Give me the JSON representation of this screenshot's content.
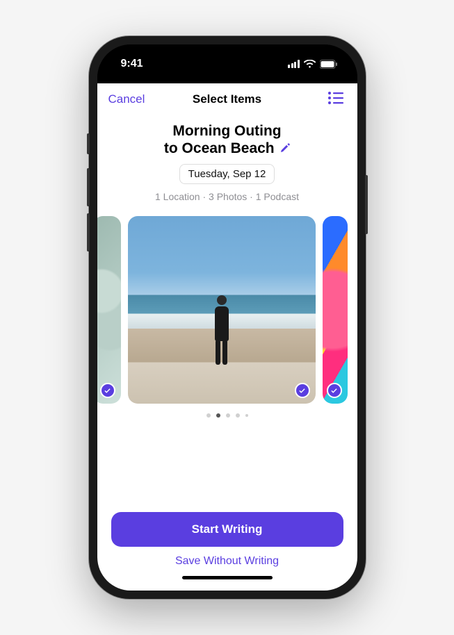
{
  "status_bar": {
    "time": "9:41"
  },
  "nav": {
    "cancel_label": "Cancel",
    "title": "Select Items",
    "right_icon": "list-icon"
  },
  "entry": {
    "title_line1": "Morning Outing",
    "title_line2": "to Ocean Beach",
    "date": "Tuesday, Sep 12",
    "summary": "1 Location · 3 Photos · 1 Podcast"
  },
  "carousel": {
    "items": [
      {
        "selected": true
      },
      {
        "selected": true
      },
      {
        "selected": true
      }
    ],
    "page_count": 5,
    "active_page_index": 1
  },
  "actions": {
    "primary": "Start Writing",
    "secondary": "Save Without Writing"
  },
  "colors": {
    "accent": "#5A3EE0"
  }
}
